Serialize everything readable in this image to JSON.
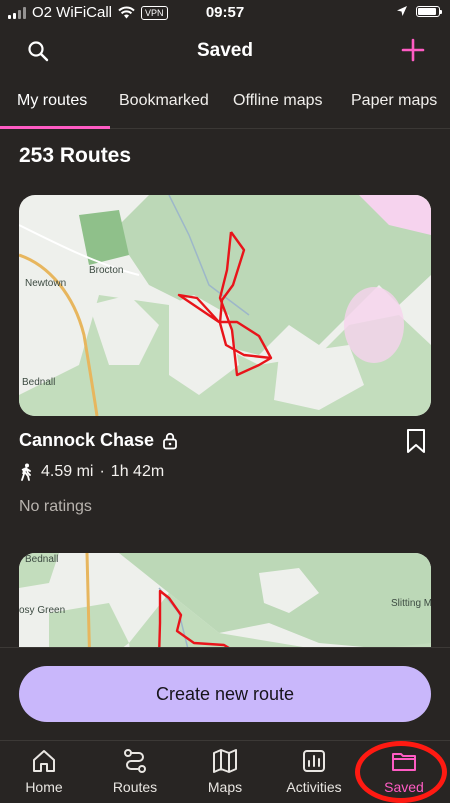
{
  "status_bar": {
    "carrier": "O2 WiFiCall",
    "vpn": "VPN",
    "time": "09:57"
  },
  "header": {
    "title": "Saved"
  },
  "tabs": [
    {
      "label": "My routes",
      "active": true
    },
    {
      "label": "Bookmarked",
      "active": false
    },
    {
      "label": "Offline maps",
      "active": false
    },
    {
      "label": "Paper maps",
      "active": false
    }
  ],
  "routes_count": "253 Routes",
  "routes": [
    {
      "name": "Cannock Chase",
      "distance": "4.59 mi",
      "separator": "·",
      "duration": "1h 42m",
      "ratings": "No ratings",
      "map_labels": {
        "place1": "Brocton",
        "place2": "Newtown",
        "place3": "Bednall"
      }
    },
    {
      "map_labels": {
        "place1": "Bednall",
        "place2": "osy Green",
        "place3": "Slitting M"
      }
    }
  ],
  "create_button": "Create new route",
  "bottom_nav": [
    {
      "label": "Home",
      "icon": "home-icon"
    },
    {
      "label": "Routes",
      "icon": "routes-icon"
    },
    {
      "label": "Maps",
      "icon": "map-icon"
    },
    {
      "label": "Activities",
      "icon": "activities-icon"
    },
    {
      "label": "Saved",
      "icon": "folder-icon",
      "active": true
    }
  ],
  "colors": {
    "background": "#282523",
    "accent_pink": "#ff5cc4",
    "create_button": "#c9b7fb",
    "route_line": "#e8141a",
    "annotation": "#ff1a12"
  }
}
